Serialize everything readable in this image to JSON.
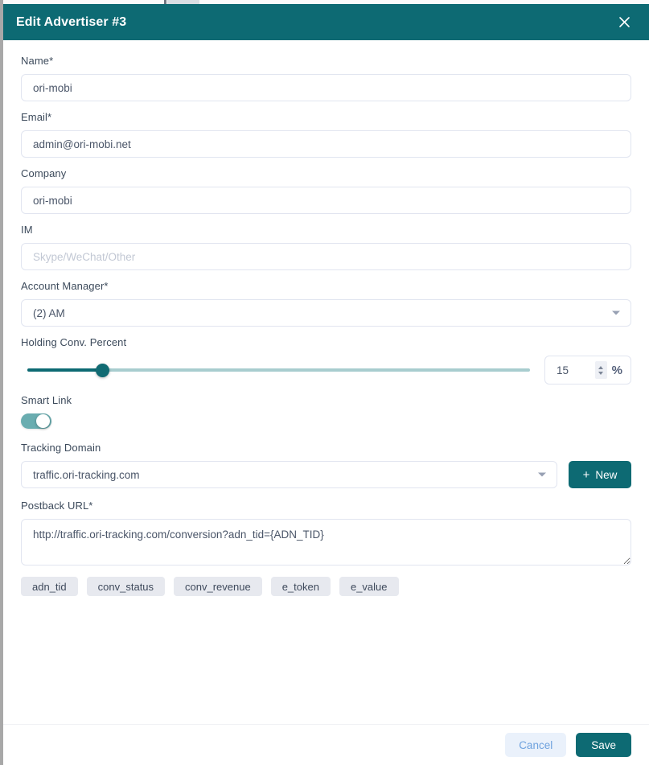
{
  "header": {
    "title": "Edit Advertiser #3",
    "close_icon": "close-icon",
    "bg_color": "#0d6a73"
  },
  "form": {
    "name": {
      "label": "Name*",
      "value": "ori-mobi",
      "placeholder": ""
    },
    "email": {
      "label": "Email*",
      "value": "admin@ori-mobi.net",
      "placeholder": ""
    },
    "company": {
      "label": "Company",
      "value": "ori-mobi",
      "placeholder": ""
    },
    "im": {
      "label": "IM",
      "value": "",
      "placeholder": "Skype/WeChat/Other"
    },
    "account_manager": {
      "label": "Account Manager*",
      "value": "(2) AM",
      "caret_icon": "chevron-down-icon"
    },
    "holding_conv_percent": {
      "label": "Holding Conv. Percent",
      "value": "15",
      "unit": "%",
      "min": 0,
      "max": 100,
      "spinner_up_icon": "chevron-up-icon",
      "spinner_down_icon": "chevron-down-icon"
    },
    "smart_link": {
      "label": "Smart Link",
      "enabled": true,
      "state_text": "on"
    },
    "tracking_domain": {
      "label": "Tracking Domain",
      "value": "traffic.ori-tracking.com",
      "caret_icon": "chevron-down-icon",
      "new_button": {
        "label": "New",
        "icon": "plus-icon"
      }
    },
    "postback_url": {
      "label": "Postback URL*",
      "value": "http://traffic.ori-tracking.com/conversion?adn_tid={ADN_TID}",
      "placeholder": ""
    },
    "macros": [
      {
        "label": "adn_tid"
      },
      {
        "label": "conv_status"
      },
      {
        "label": "conv_revenue"
      },
      {
        "label": "e_token"
      },
      {
        "label": "e_value"
      }
    ]
  },
  "footer": {
    "cancel_label": "Cancel",
    "save_label": "Save",
    "save_color": "#0d6a73",
    "cancel_color": "#6fa2de"
  }
}
